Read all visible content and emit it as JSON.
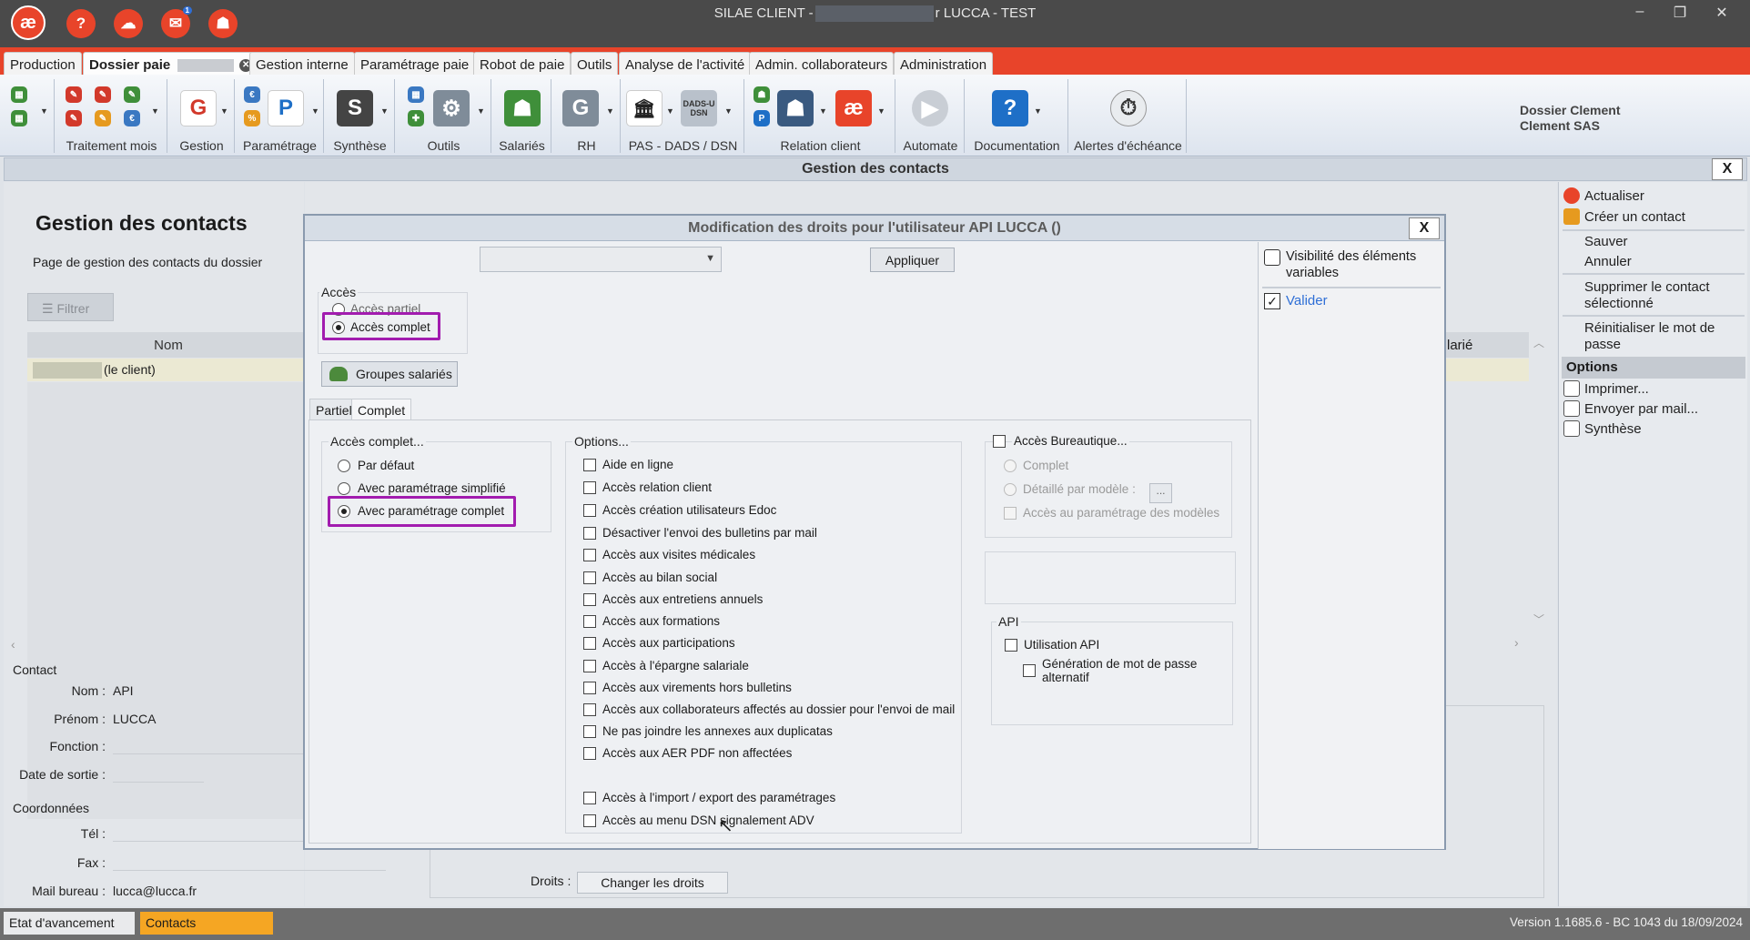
{
  "window": {
    "title_prefix": "SILAE CLIENT -",
    "title_suffix": "r LUCCA - TEST",
    "controls": {
      "minimize": "–",
      "restore": "❐",
      "close": "✕"
    }
  },
  "titlebar_icons": [
    {
      "name": "silae-logo-icon",
      "glyph": "æ"
    },
    {
      "name": "help-icon",
      "glyph": "?"
    },
    {
      "name": "chat-icon",
      "glyph": "☁"
    },
    {
      "name": "messages-icon",
      "glyph": "✉",
      "badge": "1"
    },
    {
      "name": "user-icon",
      "glyph": "☗"
    }
  ],
  "main_tabs": [
    {
      "label": "Production"
    },
    {
      "label": "Dossier paie",
      "active": true
    },
    {
      "label": "Gestion interne"
    },
    {
      "label": "Paramétrage paie"
    },
    {
      "label": "Robot de paie"
    },
    {
      "label": "Outils"
    },
    {
      "label": "Analyse de l'activité"
    },
    {
      "label": "Admin. collaborateurs"
    },
    {
      "label": "Administration"
    }
  ],
  "ribbon": {
    "groups": [
      "Traitement mois",
      "Gestion",
      "Paramétrage",
      "Synthèse",
      "Outils",
      "Salariés",
      "RH",
      "PAS - DADS / DSN",
      "Relation client",
      "Automate",
      "Documentation",
      "Alertes d'échéance"
    ],
    "dossier_line1": "Dossier Clement",
    "dossier_line2": "Clement SAS",
    "dadsu_label": "DADS-U DSN"
  },
  "page": {
    "window_title": "Gestion des contacts",
    "close_label": "X",
    "heading": "Gestion des contacts",
    "subtitle": "Page de gestion des contacts du dossier",
    "filter_label": "Filtrer",
    "column_nom": "Nom",
    "column_salarie": "larié",
    "row1_suffix": "(le client)"
  },
  "contact": {
    "section": "Contact",
    "nom_label": "Nom :",
    "nom": "API",
    "prenom_label": "Prénom :",
    "prenom": "LUCCA",
    "fonction_label": "Fonction :",
    "date_sortie_label": "Date de sortie :",
    "coord_section": "Coordonnées",
    "tel_label": "Tél :",
    "fax_label": "Fax :",
    "mail_label": "Mail bureau :",
    "mail": "lucca@lucca.fr"
  },
  "droits": {
    "label": "Droits :",
    "button": "Changer les droits"
  },
  "right_actions": {
    "actualiser": "Actualiser",
    "creer": "Créer un contact",
    "sauver": "Sauver",
    "annuler": "Annuler",
    "supprimer": "Supprimer le contact sélectionné",
    "reinit": "Réinitialiser le mot de passe",
    "options": "Options",
    "imprimer": "Imprimer...",
    "envoyer": "Envoyer par mail...",
    "synthese": "Synthèse"
  },
  "modal": {
    "title": "Modification des droits pour l'utilisateur API LUCCA ()",
    "close_label": "X",
    "combo_value": "",
    "apply_label": "Appliquer",
    "acces_legend": "Accès",
    "acces_partiel": "Accès partiel",
    "acces_complet": "Accès complet",
    "groupes_button": "Groupes salariés",
    "subtabs": [
      "Partiel",
      "Complet"
    ],
    "complet_legend": "Accès complet...",
    "complet_options": [
      "Par défaut",
      "Avec paramétrage simplifié",
      "Avec paramétrage complet"
    ],
    "options_legend": "Options...",
    "options": [
      "Aide en ligne",
      "Accès relation client",
      "Accès création utilisateurs Edoc",
      "Désactiver l'envoi des bulletins par mail",
      "Accès aux visites médicales",
      "Accès au bilan social",
      "Accès aux entretiens annuels",
      "Accès aux formations",
      "Accès aux participations",
      "Accès à l'épargne salariale",
      "Accès aux virements hors bulletins",
      "Accès aux collaborateurs affectés au dossier pour l'envoi de mail",
      "Ne pas joindre les annexes aux duplicatas",
      "Accès aux AER PDF non affectées"
    ],
    "options_extra": [
      "Accès à l'import / export des paramétrages",
      "Accès au menu DSN signalement ADV"
    ],
    "bureautique_label": "Accès Bureautique...",
    "bureautique_complet": "Complet",
    "bureautique_detail": "Détaillé par modèle :",
    "bureautique_ellipsis": "...",
    "bureautique_param": "Accès au paramétrage des modèles",
    "api_legend": "API",
    "api_utilisation": "Utilisation API",
    "api_generation": "Génération de mot de passe alternatif",
    "side_visibility": "Visibilité des éléments variables",
    "side_valider": "Valider"
  },
  "statusbar": {
    "etat": "Etat d'avancement",
    "contacts": "Contacts",
    "version": "Version 1.1685.6 - BC 1043 du 18/09/2024"
  },
  "colors": {
    "accent": "#e8442a",
    "highlight": "#a21caf",
    "status_active": "#f5a623"
  }
}
